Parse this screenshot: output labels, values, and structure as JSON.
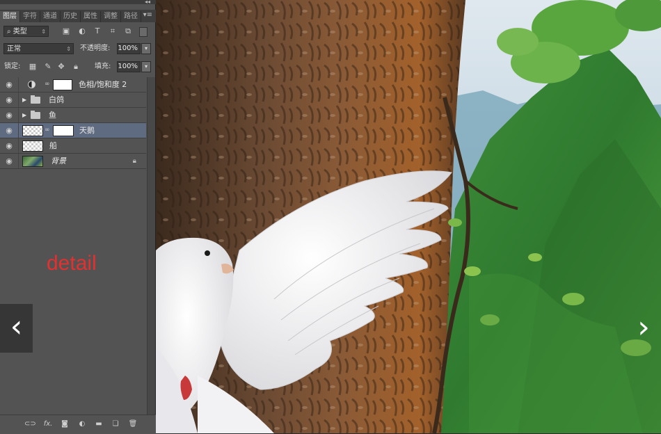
{
  "panel": {
    "tabs": [
      "图层",
      "字符",
      "通道",
      "历史",
      "属性",
      "调整",
      "路径"
    ],
    "active_tab": 0,
    "filter": {
      "label": "类型"
    },
    "blend_mode": "正常",
    "opacity_label": "不透明度:",
    "opacity_value": "100%",
    "lock_label": "锁定:",
    "fill_label": "填充:",
    "fill_value": "100%",
    "layers": [
      {
        "name": "色相/饱和度 2",
        "type": "adjustment"
      },
      {
        "name": "白鸽",
        "type": "group"
      },
      {
        "name": "鱼",
        "type": "group"
      },
      {
        "name": "天鹅",
        "type": "masked",
        "selected": true
      },
      {
        "name": "船",
        "type": "layer"
      },
      {
        "name": "背景",
        "type": "background",
        "locked": true
      }
    ]
  },
  "overlay": {
    "detail_text": "detail"
  },
  "nav": {
    "prev": "‹",
    "next": "›"
  },
  "colors": {
    "panel_bg": "#535353",
    "selected_layer": "#5f6b80",
    "detail_text": "#e53030"
  }
}
